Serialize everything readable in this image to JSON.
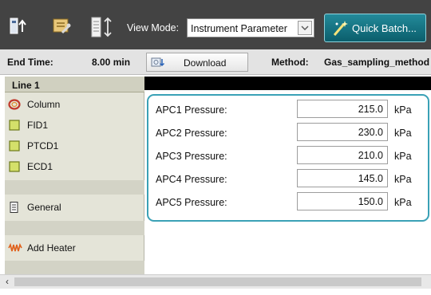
{
  "toolbar": {
    "view_mode_label": "View Mode:",
    "view_mode_value": "Instrument Parameter",
    "quick_batch_label": "Quick Batch...",
    "icons": [
      "instrument-icon",
      "settings-wrench-icon",
      "data-columns-icon",
      "magic-wand-icon"
    ]
  },
  "infobar": {
    "end_time_label": "End Time:",
    "end_time_value": "8.00 min",
    "download_label": "Download",
    "method_label": "Method:",
    "method_value": "Gas_sampling_method"
  },
  "sidebar": {
    "line_header": "Line 1",
    "items": [
      {
        "label": "Column",
        "icon": "column-icon"
      },
      {
        "label": "FID1",
        "icon": "detector-icon"
      },
      {
        "label": "PTCD1",
        "icon": "detector-icon"
      },
      {
        "label": "ECD1",
        "icon": "detector-icon"
      },
      {
        "label": "General",
        "icon": "general-icon"
      },
      {
        "label": "Add Heater",
        "icon": "heater-icon"
      }
    ]
  },
  "params": {
    "unit": "kPa",
    "rows": [
      {
        "label": "APC1 Pressure:",
        "value": "215.0"
      },
      {
        "label": "APC2 Pressure:",
        "value": "230.0"
      },
      {
        "label": "APC3 Pressure:",
        "value": "210.0"
      },
      {
        "label": "APC4 Pressure:",
        "value": "145.0"
      },
      {
        "label": "APC5 Pressure:",
        "value": "150.0"
      }
    ]
  },
  "colors": {
    "toolbar_bg": "#434343",
    "accent_teal": "#3aa1b6",
    "panel_bg": "#e4e4d8"
  }
}
